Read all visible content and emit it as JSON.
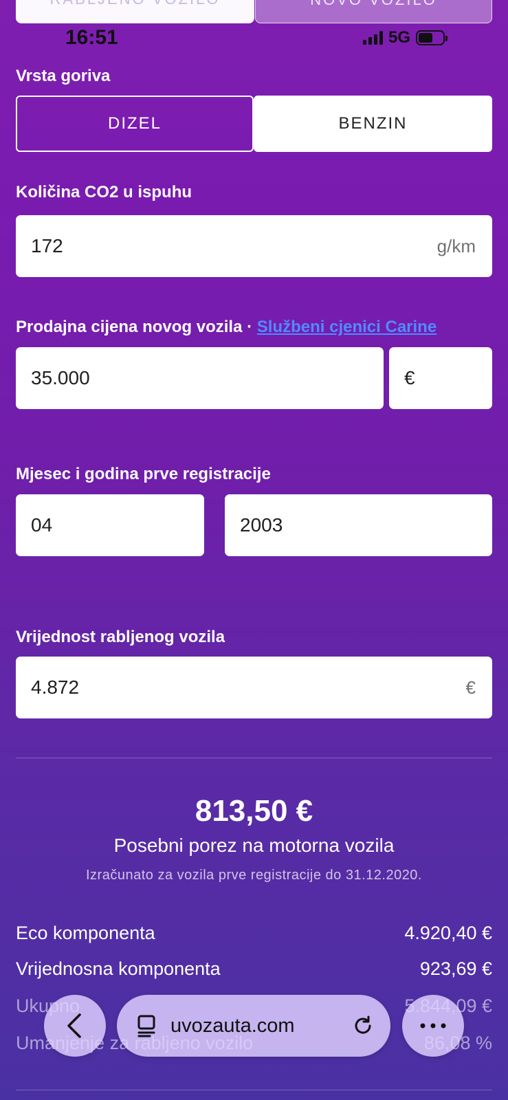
{
  "top_tabs": {
    "left": "RABLJENO VOZILO",
    "right": "NOVO VOZILO"
  },
  "status_bar": {
    "time": "16:51",
    "network": "5G"
  },
  "fuel": {
    "label": "Vrsta goriva",
    "options": [
      "DIZEL",
      "BENZIN"
    ],
    "selected": "DIZEL"
  },
  "co2": {
    "label": "Količina CO2 u ispuhu",
    "value": "172",
    "unit": "g/km"
  },
  "price": {
    "label": "Prodajna cijena novog vozila",
    "separator": "·",
    "link": "Službeni cjenici Carine",
    "value": "35.000",
    "currency": "€"
  },
  "registration": {
    "label": "Mjesec i godina prve registracije",
    "month": "04",
    "year": "2003"
  },
  "used_value": {
    "label": "Vrijednost rabljenog vozila",
    "value": "4.872",
    "unit": "€"
  },
  "result": {
    "amount": "813,50 €",
    "title": "Posebni porez na motorna vozila",
    "note": "Izračunato za vozila prve registracije do 31.12.2020."
  },
  "breakdown": [
    {
      "label": "Eco komponenta",
      "value": "4.920,40 €"
    },
    {
      "label": "Vrijednosna komponenta",
      "value": "923,69 €"
    },
    {
      "label": "Ukupno",
      "value": "5.844,09 €"
    },
    {
      "label": "Umanjenje za rabljeno vozilo",
      "value": "86,08 %"
    }
  ],
  "browser": {
    "url": "uvozauta.com"
  }
}
